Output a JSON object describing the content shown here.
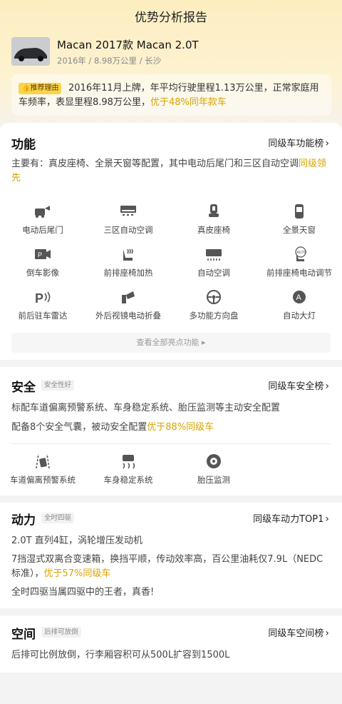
{
  "header": {
    "title": "优势分析报告"
  },
  "car": {
    "name": "Macan 2017款 Macan 2.0T",
    "meta": "2016年 / 8.98万公里 / 长沙"
  },
  "reason": {
    "tag": "推荐理由",
    "line1": "2016年11月上牌，年平均行驶里程1.13万公里，正常家庭用",
    "line2_prefix": "车频率，表显里程8.98万公里，",
    "line2_highlight": "优于48%同年款车"
  },
  "features": {
    "title": "功能",
    "link": "同级车功能榜",
    "desc_prefix": "主要有：真皮座椅、全景天窗等配置，其中电动后尾门和三区自动空调",
    "desc_highlight": "同级领先",
    "items": [
      {
        "label": "电动后尾门",
        "icon": "tailgate-icon"
      },
      {
        "label": "三区自动空调",
        "icon": "ac-icon"
      },
      {
        "label": "真皮座椅",
        "icon": "seat-icon"
      },
      {
        "label": "全景天窗",
        "icon": "sunroof-icon"
      },
      {
        "label": "倒车影像",
        "icon": "camera-icon"
      },
      {
        "label": "前排座椅加热",
        "icon": "seat-heat-icon"
      },
      {
        "label": "自动空调",
        "icon": "auto-ac-icon"
      },
      {
        "label": "前排座椅电动调节",
        "icon": "seat-adjust-icon"
      },
      {
        "label": "前后驻车雷达",
        "icon": "parking-radar-icon"
      },
      {
        "label": "外后视镜电动折叠",
        "icon": "mirror-icon"
      },
      {
        "label": "多功能方向盘",
        "icon": "steering-icon"
      },
      {
        "label": "自动大灯",
        "icon": "headlight-icon"
      }
    ],
    "more": "查看全部亮点功能 ▸"
  },
  "safety": {
    "title": "安全",
    "badge": "安全性好",
    "link": "同级车安全榜",
    "line1": "标配车道偏离预警系统、车身稳定系统、胎压监测等主动安全配置",
    "line2_prefix": "配备8个安全气囊，被动安全配置",
    "line2_highlight": "优于88%同级车",
    "items": [
      {
        "label": "车道偏离预警系统",
        "icon": "lane-icon"
      },
      {
        "label": "车身稳定系统",
        "icon": "stability-icon"
      },
      {
        "label": "胎压监测",
        "icon": "tire-icon"
      }
    ]
  },
  "power": {
    "title": "动力",
    "badge": "全时四驱",
    "link": "同级车动力TOP1",
    "line1": "2.0T 直列4缸，涡轮增压发动机",
    "line2a": "7挡湿式双离合变速箱，换挡平顺，传动效率高，百公里油耗仅7.9L（NEDC",
    "line2b_prefix": "标准），",
    "line2b_highlight": "优于57%同级车",
    "line3": "全时四驱当属四驱中的王者，真香!"
  },
  "space": {
    "title": "空间",
    "badge": "后排可放倒",
    "link": "同级车空间榜",
    "line1": "后排可比例放倒，行李厢容积可从500L扩容到1500L"
  }
}
